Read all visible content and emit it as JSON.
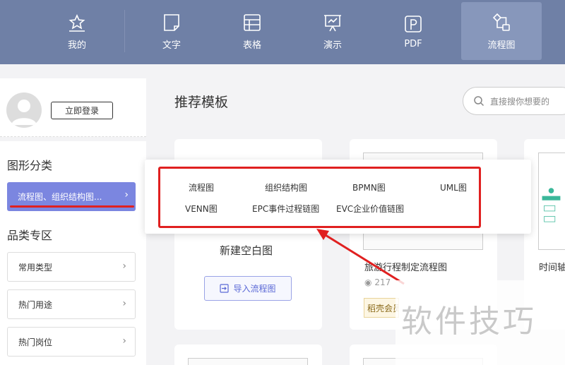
{
  "nav": {
    "items": [
      {
        "label": "我的",
        "icon": "star-icon"
      },
      {
        "label": "文字",
        "icon": "document-icon"
      },
      {
        "label": "表格",
        "icon": "table-icon"
      },
      {
        "label": "演示",
        "icon": "presentation-icon"
      },
      {
        "label": "PDF",
        "icon": "pdf-icon"
      },
      {
        "label": "流程图",
        "icon": "flowchart-icon"
      }
    ],
    "active": "流程图"
  },
  "user": {
    "login_label": "立即登录"
  },
  "sidebar": {
    "graphic_category_title": "图形分类",
    "active_category": "流程图、组织结构图...",
    "category_zone_title": "品类专区",
    "items": [
      {
        "label": "常用类型"
      },
      {
        "label": "热门用途"
      },
      {
        "label": "热门岗位"
      }
    ]
  },
  "main": {
    "title": "推荐模板",
    "search_placeholder": "直接搜你想要的",
    "blank_card": {
      "title": "新建空白图",
      "import_label": "导入流程图"
    },
    "templates": [
      {
        "name": "旅游行程制定流程图",
        "views": "217",
        "tag": "稻壳会员"
      },
      {
        "name": "时间轴"
      }
    ]
  },
  "popup": {
    "options": [
      "流程图",
      "组织结构图",
      "BPMN图",
      "UML图",
      "VENN图",
      "EPC事件过程链图",
      "EVC企业价值链图"
    ]
  },
  "watermark": {
    "text": "软件技巧"
  },
  "colors": {
    "nav_bg": "#6f80a6",
    "nav_active": "#8797bb",
    "accent": "#7b86e0",
    "highlight_red": "#e02020"
  }
}
